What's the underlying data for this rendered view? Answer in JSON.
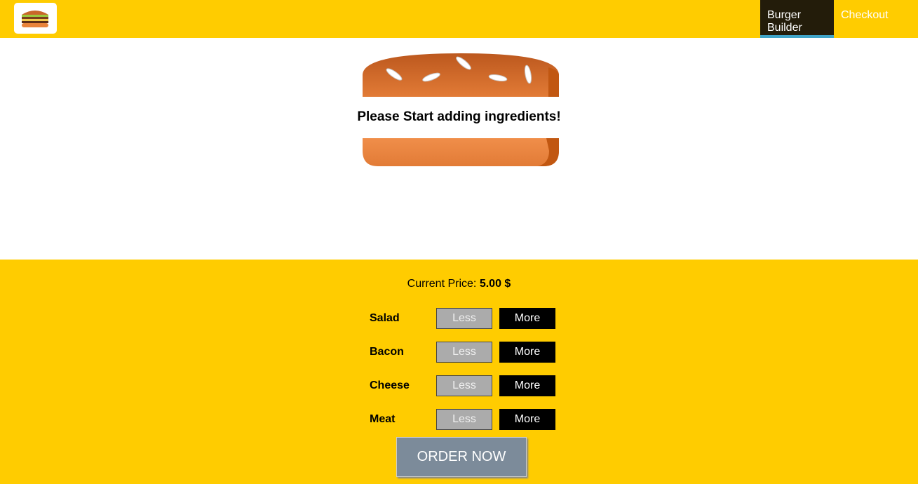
{
  "toolbar": {
    "logo_icon": "burger-logo-icon",
    "nav": [
      {
        "label": "Burger Builder",
        "active": true
      },
      {
        "label": "Checkout",
        "active": false
      }
    ]
  },
  "burger": {
    "prompt": "Please Start adding ingredients!"
  },
  "controls": {
    "price_label": "Current Price:",
    "price_value": "5.00 $",
    "ingredients": [
      {
        "label": "Salad",
        "less": "Less",
        "more": "More"
      },
      {
        "label": "Bacon",
        "less": "Less",
        "more": "More"
      },
      {
        "label": "Cheese",
        "less": "Less",
        "more": "More"
      },
      {
        "label": "Meat",
        "less": "Less",
        "more": "More"
      }
    ],
    "order_button": "ORDER NOW"
  },
  "colors": {
    "toolbar": "#FFCC00",
    "active_nav": "#231C0A",
    "active_underline": "#40A4C8",
    "bread": "#E27B36",
    "order_button": "#7C8B9A"
  }
}
